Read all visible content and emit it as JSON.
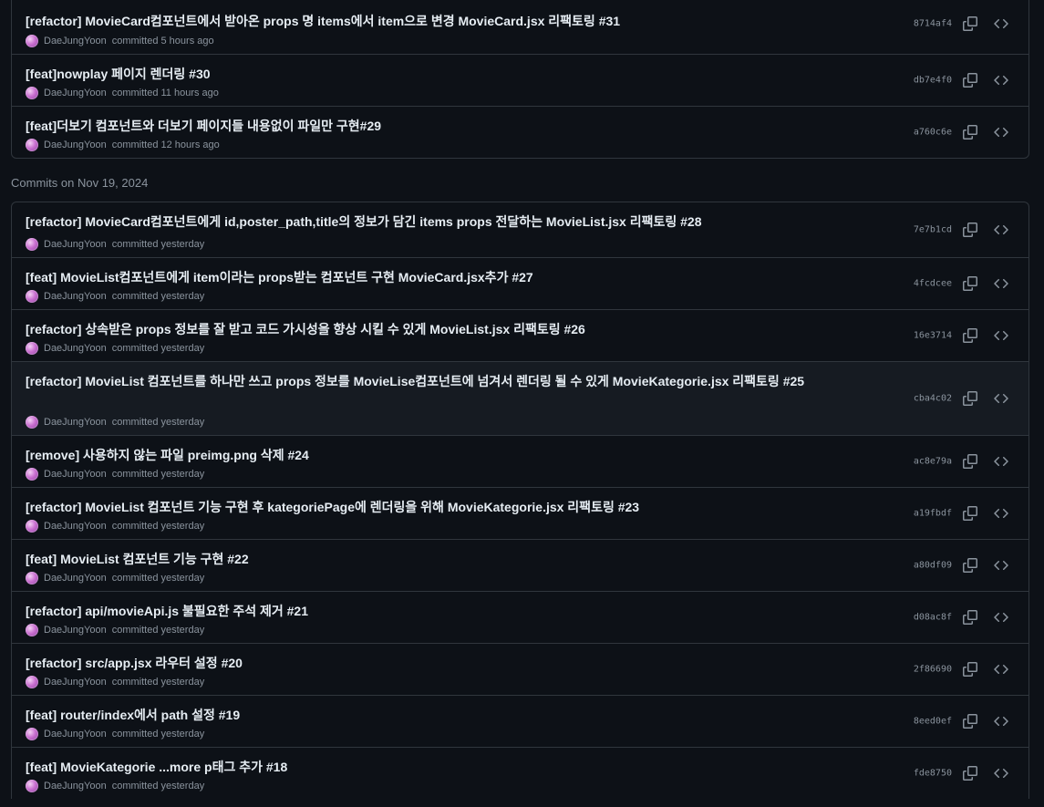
{
  "group1": {
    "commits": [
      {
        "title": "[refactor] MovieCard컴포넌트에서 받아온 props 명 items에서 item으로 변경 MovieCard.jsx 리팩토링 #31",
        "author": "DaeJungYoon",
        "time": "committed 5 hours ago",
        "sha": "8714af4"
      },
      {
        "title": "[feat]nowplay 페이지 렌더링 #30",
        "author": "DaeJungYoon",
        "time": "committed 11 hours ago",
        "sha": "db7e4f0"
      },
      {
        "title": "[feat]더보기 컴포넌트와 더보기 페이지들 내용없이 파일만 구현#29",
        "author": "DaeJungYoon",
        "time": "committed 12 hours ago",
        "sha": "a760c6e"
      }
    ]
  },
  "group2": {
    "heading": "Commits on Nov 19, 2024",
    "commits": [
      {
        "title": "[refactor] MovieCard컴포넌트에게 id,poster_path,title의 정보가 담긴 items props 전달하는 MovieList.jsx 리팩토링 #28",
        "author": "DaeJungYoon",
        "time": "committed yesterday",
        "sha": "7e7b1cd"
      },
      {
        "title": "[feat] MovieList컴포넌트에게 item이라는 props받는 컴포넌트 구현 MovieCard.jsx추가 #27",
        "author": "DaeJungYoon",
        "time": "committed yesterday",
        "sha": "4fcdcee"
      },
      {
        "title": "[refactor] 상속받은 props 정보를 잘 받고 코드 가시성을 향상 시킬 수 있게 MovieList.jsx 리팩토링 #26",
        "author": "DaeJungYoon",
        "time": "committed yesterday",
        "sha": "16e3714"
      },
      {
        "title": "[refactor] MovieList 컴포넌트를 하나만 쓰고 props 정보를 MovieLise컴포넌트에 넘겨서 렌더링 될 수 있게 MovieKategorie.jsx 리팩토링 #25",
        "author": "DaeJungYoon",
        "time": "committed yesterday",
        "sha": "cba4c02"
      },
      {
        "title": "[remove] 사용하지 않는 파일 preimg.png 삭제 #24",
        "author": "DaeJungYoon",
        "time": "committed yesterday",
        "sha": "ac8e79a"
      },
      {
        "title": "[refactor] MovieList 컴포넌트 기능 구현 후 kategoriePage에 렌더링을 위해 MovieKategorie.jsx 리팩토링 #23",
        "author": "DaeJungYoon",
        "time": "committed yesterday",
        "sha": "a19fbdf"
      },
      {
        "title": "[feat] MovieList 컴포넌트 기능 구현 #22",
        "author": "DaeJungYoon",
        "time": "committed yesterday",
        "sha": "a80df09"
      },
      {
        "title": "[refactor] api/movieApi.js 불필요한 주석 제거 #21",
        "author": "DaeJungYoon",
        "time": "committed yesterday",
        "sha": "d08ac8f"
      },
      {
        "title": "[refactor] src/app.jsx 라우터 설정 #20",
        "author": "DaeJungYoon",
        "time": "committed yesterday",
        "sha": "2f86690"
      },
      {
        "title": "[feat] router/index에서 path 설정 #19",
        "author": "DaeJungYoon",
        "time": "committed yesterday",
        "sha": "8eed0ef"
      },
      {
        "title": "[feat] MovieKategorie ...more p태그 추가 #18",
        "author": "DaeJungYoon",
        "time": "committed yesterday",
        "sha": "fde8750"
      }
    ]
  },
  "icons": {
    "copy": "copy-icon",
    "browse_code": "code-icon",
    "avatar": "avatar"
  },
  "colors": {
    "background": "#0d1117",
    "border": "#30363d",
    "text": "#e6edf3",
    "muted": "#8b949e"
  }
}
